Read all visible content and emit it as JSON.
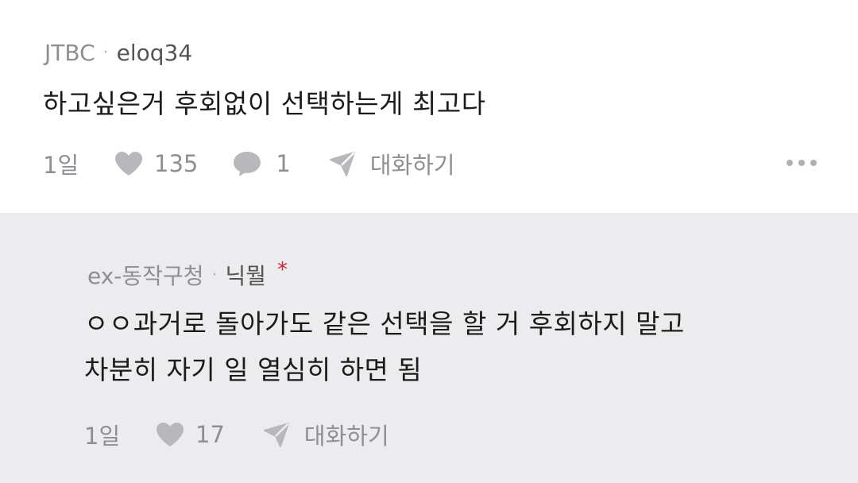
{
  "comment": {
    "source": "JTBC",
    "author": "eloq34",
    "text": "하고싶은거 후회없이 선택하는게 최고다",
    "time": "1일",
    "likes": "135",
    "replies": "1",
    "chat_label": "대화하기",
    "icons": [
      "heart-icon",
      "speech-bubble-icon",
      "send-icon",
      "more-dots-icon"
    ]
  },
  "reply": {
    "source": "ex-동작구청",
    "author": "닉뭘",
    "badge": "*",
    "text_lines": [
      "ㅇㅇ과거로 돌아가도 같은 선택을 할 거 후회하지 말고",
      "차분히 자기 일 열심히 하면 됨"
    ],
    "time": "1일",
    "likes": "17",
    "chat_label": "대화하기",
    "icons": [
      "heart-icon",
      "send-icon"
    ]
  },
  "colors": {
    "background": "#ffffff",
    "reply_background": "#ececee",
    "meta_text": "#8e8e93",
    "body_text": "#1b1b1b",
    "badge_red": "#d0232a"
  }
}
